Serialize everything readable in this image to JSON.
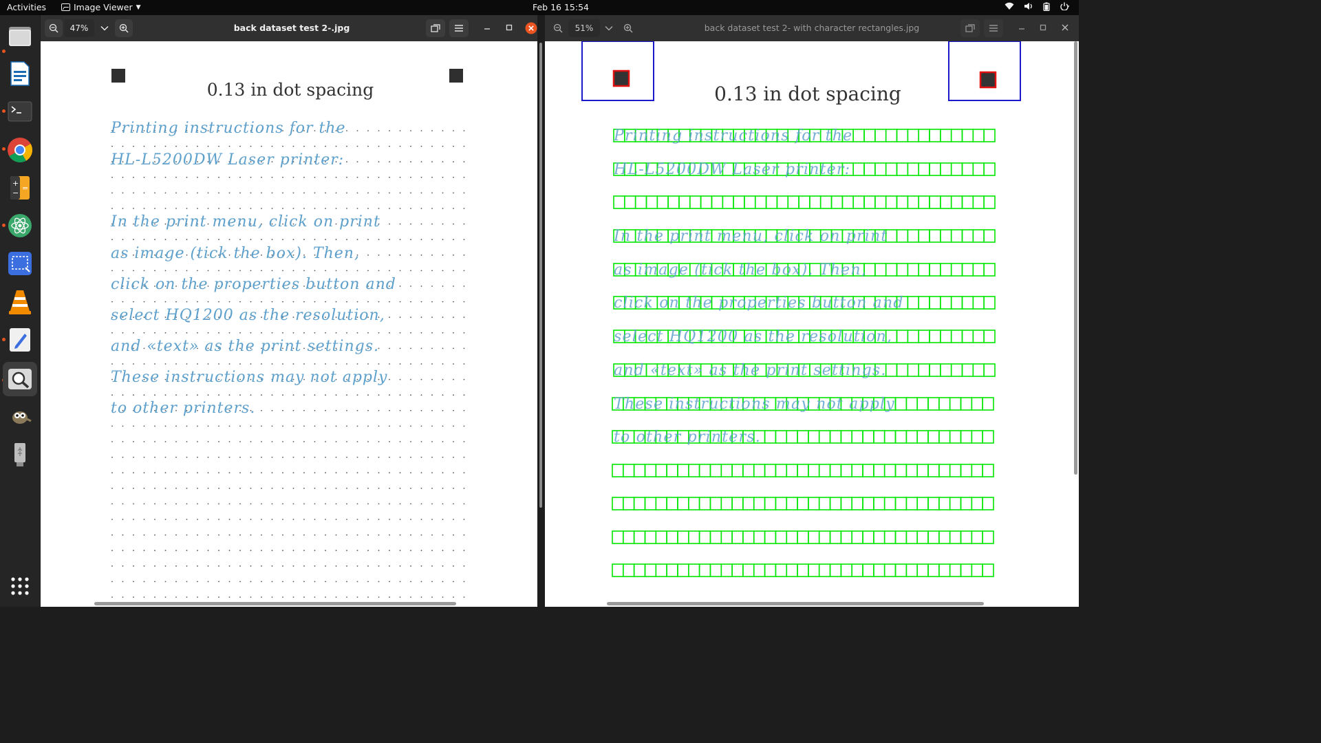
{
  "topbar": {
    "activities": "Activities",
    "app_name": "Image Viewer",
    "clock": "Feb 16  15:54",
    "tray_icons": [
      "wifi-icon",
      "volume-icon",
      "battery-icon",
      "power-icon"
    ]
  },
  "dock": {
    "items": [
      "files",
      "writer",
      "terminal",
      "chrome",
      "calculator",
      "atom",
      "screenshot",
      "vlc",
      "text-editor",
      "image-viewer",
      "gimp",
      "usb-drive",
      "app-grid"
    ]
  },
  "left_window": {
    "zoom": "47%",
    "title": "back dataset test 2-.jpg",
    "doc_title": "0.13 in dot spacing",
    "lines": [
      "Printing instructions for the",
      "HL-L5200DW Laser printer:",
      "",
      "In the print menu, click on print",
      "as image (tick the box). Then,",
      "click on the properties button and",
      "select HQ1200 as the resolution,",
      "and «text» as the print settings.",
      "These instructions may not apply",
      "to other printers."
    ]
  },
  "right_window": {
    "zoom": "51%",
    "title": "back dataset test 2- with character rectangles.jpg",
    "doc_title": "0.13 in dot spacing"
  },
  "colors": {
    "ink": "#5ea0cc",
    "box_green": "#00e600",
    "marker_blue": "#1a1acc",
    "marker_red": "#e01010",
    "close_orange": "#e95420"
  }
}
